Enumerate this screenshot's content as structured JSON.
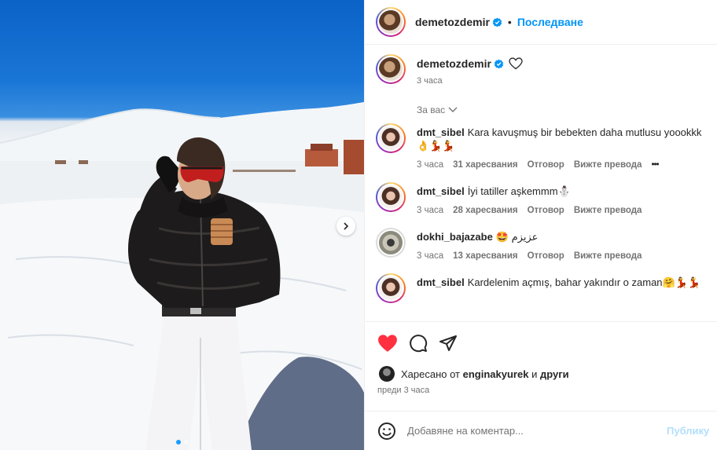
{
  "post": {
    "owner": "demetozdemir",
    "follow_label": "Последване",
    "caption_time": "3 часа",
    "for_you_label": "За вас",
    "carousel": {
      "slides": 2,
      "active": 1
    }
  },
  "comments": [
    {
      "user": "dmt_sibel",
      "text": "Kara kavuşmuş bir bebekten daha mutlusu yoookkk",
      "text_line2": "👌💃💃",
      "time": "3 часа",
      "likes": "31 харесвания",
      "reply": "Отговор",
      "translate": "Вижте превода",
      "more": "•••"
    },
    {
      "user": "dmt_sibel",
      "text": "İyi tatiller aşkemmm⛄",
      "time": "3 часа",
      "likes": "28 харесвания",
      "reply": "Отговор",
      "translate": "Вижте превода"
    },
    {
      "user": "dokhi_bajazabe",
      "text": "🤩 عزيزم",
      "time": "3 часа",
      "likes": "13 харесвания",
      "reply": "Отговор",
      "translate": "Вижте превода"
    },
    {
      "user": "dmt_sibel",
      "text": "Kardelenim açmış, bahar yakındır o zaman🤗💃💃",
      "time": "",
      "likes": ""
    }
  ],
  "likes_line": {
    "prefix": "Харесано от",
    "user": "enginakyurek",
    "and": "и",
    "others": "други"
  },
  "posted": "преди 3 часа",
  "add_comment": {
    "placeholder": "Добавяне на коментар...",
    "publish": "Публику"
  },
  "colors": {
    "like_red": "#ff3040",
    "link_blue": "#0095f6",
    "verified_blue": "#0095f6"
  },
  "icons": {
    "like": "heart-filled-icon",
    "comment": "comment-icon",
    "share": "share-icon",
    "emoji": "emoji-icon"
  }
}
